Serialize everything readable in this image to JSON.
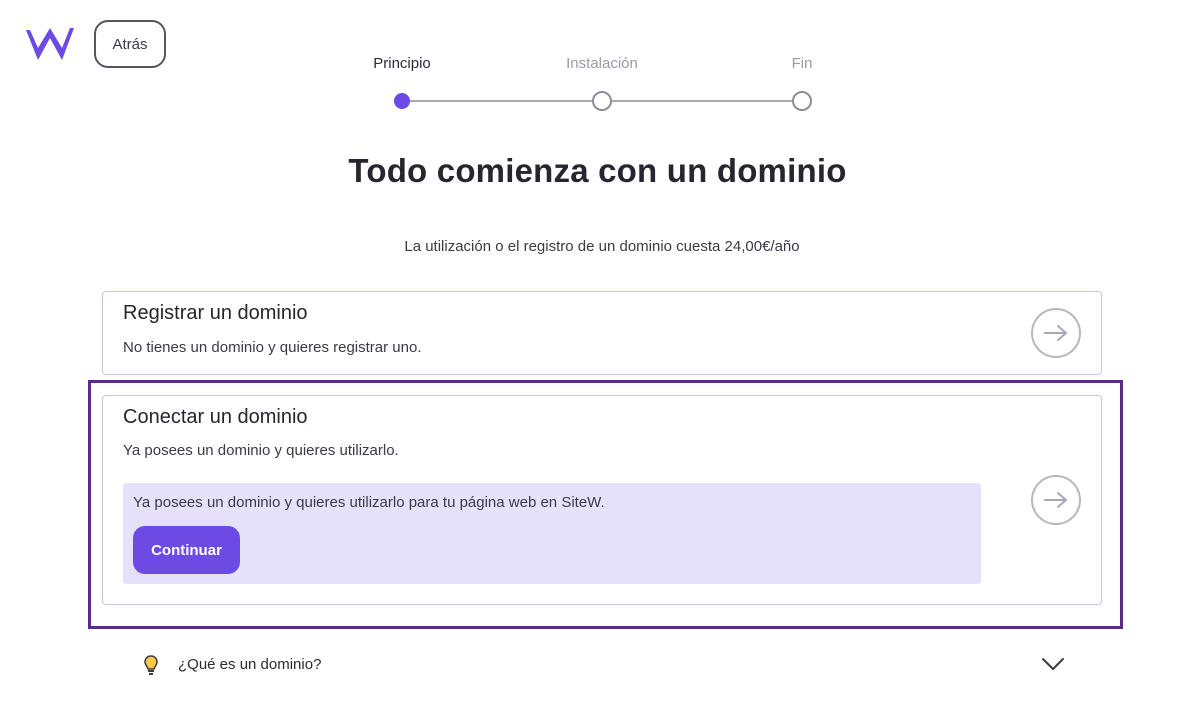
{
  "header": {
    "logo_icon": "sitew-w-logo",
    "back_label": "Atrás"
  },
  "stepper": {
    "steps": [
      {
        "label": "Principio",
        "active": true
      },
      {
        "label": "Instalación",
        "active": false
      },
      {
        "label": "Fin",
        "active": false
      }
    ]
  },
  "main": {
    "title": "Todo comienza con un dominio",
    "subtitle": "La utilización o el registro de un dominio cuesta 24,00€/año"
  },
  "options": {
    "register": {
      "title": "Registrar un dominio",
      "description": "No tienes un dominio y quieres registrar uno.",
      "icon": "arrow-right-icon"
    },
    "connect": {
      "title": "Conectar un dominio",
      "description": "Ya posees un dominio y quieres utilizarlo.",
      "detail": "Ya posees un dominio y quieres utilizarlo para tu página web en SiteW.",
      "continue_label": "Continuar",
      "icon": "arrow-right-icon"
    }
  },
  "faq": {
    "icon": "lightbulb-icon",
    "label": "¿Qué es un dominio?",
    "toggle_icon": "chevron-down-icon"
  },
  "colors": {
    "accent": "#6b4be3",
    "panel": "#e6e1fb",
    "focus_outline": "#5b2a86"
  }
}
